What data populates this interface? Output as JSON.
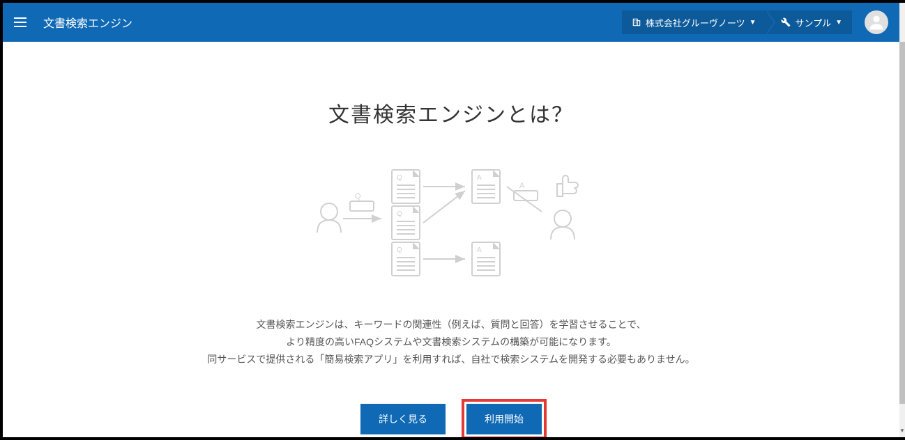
{
  "header": {
    "app_title": "文書検索エンジン",
    "breadcrumb": {
      "org": "株式会社グルーヴノーツ",
      "project": "サンプル"
    }
  },
  "main": {
    "heading": "文書検索エンジンとは？",
    "description": {
      "line1": "文書検索エンジンは、キーワードの関連性（例えば、質問と回答）を学習させることで、",
      "line2": "より精度の高いFAQシステムや文書検索システムの構築が可能になります。",
      "line3": "同サービスで提供される「簡易検索アプリ」を利用すれば、自社で検索システムを開発する必要もありません。"
    },
    "buttons": {
      "details": "詳しく見る",
      "start": "利用開始"
    }
  }
}
